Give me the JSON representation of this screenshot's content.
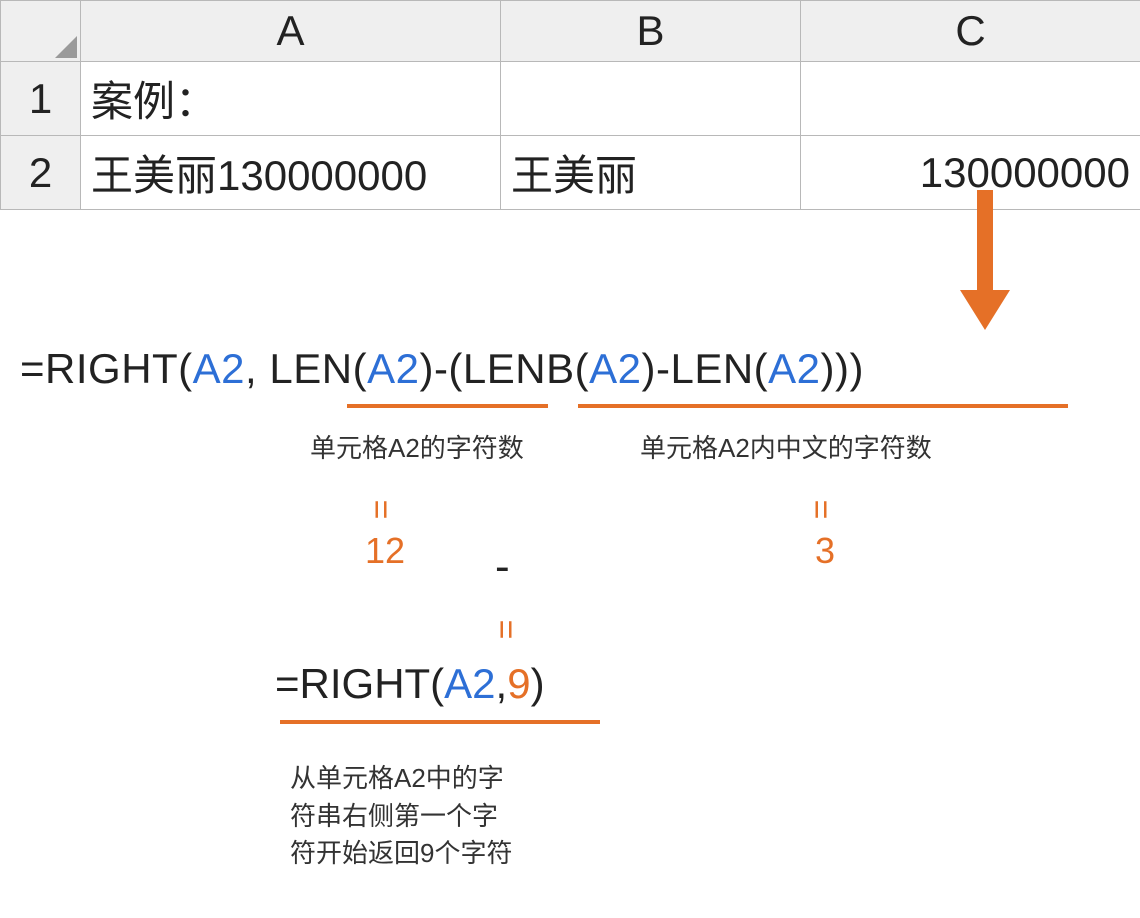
{
  "sheet": {
    "cols": [
      "A",
      "B",
      "C"
    ],
    "rows": [
      "1",
      "2"
    ],
    "cells": {
      "A1": "案例：",
      "B1": "",
      "C1": "",
      "A2": "王美丽130000000",
      "B2": "王美丽",
      "C2": "130000000"
    }
  },
  "formula1": {
    "pre": "=RIGHT(",
    "a2_1": "A2",
    "mid1": ", LEN(",
    "a2_2": "A2",
    "mid2": ")-(LENB(",
    "a2_3": "A2",
    "mid3": ")-LEN(",
    "a2_4": "A2",
    "mid4": ")))"
  },
  "notes": {
    "n1": "单元格A2的字符数",
    "n2": "单元格A2内中文的字符数",
    "eq": "=",
    "v1": "12",
    "v2": "3",
    "minus": "-"
  },
  "formula2": {
    "pre": "=RIGHT(",
    "a2": "A2",
    "comma": ",",
    "nine": "9",
    "close": ")"
  },
  "note3": {
    "l1": "从单元格A2中的字",
    "l2": "符串右侧第一个字",
    "l3": "符开始返回9个字符"
  }
}
